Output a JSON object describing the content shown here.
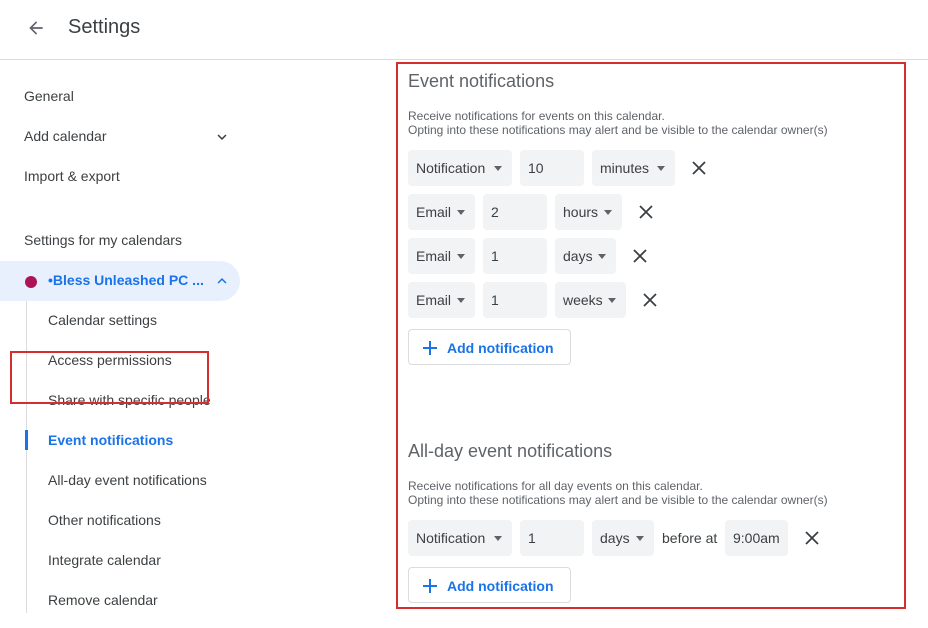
{
  "header": {
    "title": "Settings"
  },
  "sidebar": {
    "top_items": [
      {
        "label": "General"
      },
      {
        "label": "Add calendar"
      },
      {
        "label": "Import & export"
      }
    ],
    "section_label": "Settings for my calendars",
    "calendar": {
      "name": "•Bless Unleashed PC ...",
      "color": "#ad1457"
    },
    "sub_items": [
      {
        "label": "Calendar settings"
      },
      {
        "label": "Access permissions"
      },
      {
        "label": "Share with specific people"
      },
      {
        "label": "Event notifications"
      },
      {
        "label": "All-day event notifications"
      },
      {
        "label": "Other notifications"
      },
      {
        "label": "Integrate calendar"
      },
      {
        "label": "Remove calendar"
      }
    ]
  },
  "event_notifications": {
    "title": "Event notifications",
    "desc_line1": "Receive notifications for events on this calendar.",
    "desc_line2": "Opting into these notifications may alert and be visible to the calendar owner(s)",
    "rows": [
      {
        "type": "Notification",
        "amount": "10",
        "unit": "minutes"
      },
      {
        "type": "Email",
        "amount": "2",
        "unit": "hours"
      },
      {
        "type": "Email",
        "amount": "1",
        "unit": "days"
      },
      {
        "type": "Email",
        "amount": "1",
        "unit": "weeks"
      }
    ],
    "add_label": "Add notification"
  },
  "allday_notifications": {
    "title": "All-day event notifications",
    "desc_line1": "Receive notifications for all day events on this calendar.",
    "desc_line2": "Opting into these notifications may alert and be visible to the calendar owner(s)",
    "row": {
      "type": "Notification",
      "amount": "1",
      "unit": "days",
      "before_at": "before at",
      "time": "9:00am"
    },
    "add_label": "Add notification"
  },
  "colors": {
    "accent": "#1a73e8",
    "highlight": "#d32f2f",
    "selected_bg": "#e8f0fe"
  }
}
